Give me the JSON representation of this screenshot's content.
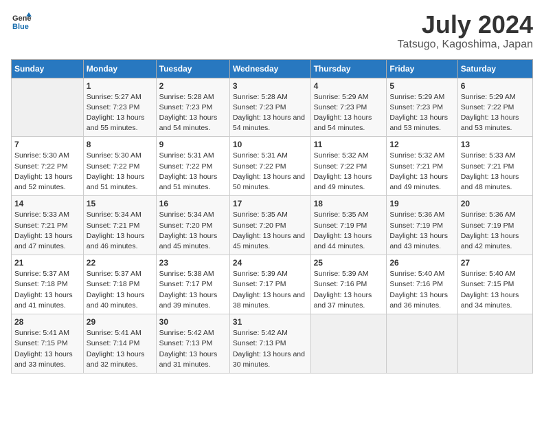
{
  "header": {
    "logo_line1": "General",
    "logo_line2": "Blue",
    "month": "July 2024",
    "location": "Tatsugo, Kagoshima, Japan"
  },
  "weekdays": [
    "Sunday",
    "Monday",
    "Tuesday",
    "Wednesday",
    "Thursday",
    "Friday",
    "Saturday"
  ],
  "weeks": [
    [
      {
        "day": "",
        "sunrise": "",
        "sunset": "",
        "daylight": ""
      },
      {
        "day": "1",
        "sunrise": "5:27 AM",
        "sunset": "7:23 PM",
        "daylight": "13 hours and 55 minutes."
      },
      {
        "day": "2",
        "sunrise": "5:28 AM",
        "sunset": "7:23 PM",
        "daylight": "13 hours and 54 minutes."
      },
      {
        "day": "3",
        "sunrise": "5:28 AM",
        "sunset": "7:23 PM",
        "daylight": "13 hours and 54 minutes."
      },
      {
        "day": "4",
        "sunrise": "5:29 AM",
        "sunset": "7:23 PM",
        "daylight": "13 hours and 54 minutes."
      },
      {
        "day": "5",
        "sunrise": "5:29 AM",
        "sunset": "7:23 PM",
        "daylight": "13 hours and 53 minutes."
      },
      {
        "day": "6",
        "sunrise": "5:29 AM",
        "sunset": "7:22 PM",
        "daylight": "13 hours and 53 minutes."
      }
    ],
    [
      {
        "day": "7",
        "sunrise": "5:30 AM",
        "sunset": "7:22 PM",
        "daylight": "13 hours and 52 minutes."
      },
      {
        "day": "8",
        "sunrise": "5:30 AM",
        "sunset": "7:22 PM",
        "daylight": "13 hours and 51 minutes."
      },
      {
        "day": "9",
        "sunrise": "5:31 AM",
        "sunset": "7:22 PM",
        "daylight": "13 hours and 51 minutes."
      },
      {
        "day": "10",
        "sunrise": "5:31 AM",
        "sunset": "7:22 PM",
        "daylight": "13 hours and 50 minutes."
      },
      {
        "day": "11",
        "sunrise": "5:32 AM",
        "sunset": "7:22 PM",
        "daylight": "13 hours and 49 minutes."
      },
      {
        "day": "12",
        "sunrise": "5:32 AM",
        "sunset": "7:21 PM",
        "daylight": "13 hours and 49 minutes."
      },
      {
        "day": "13",
        "sunrise": "5:33 AM",
        "sunset": "7:21 PM",
        "daylight": "13 hours and 48 minutes."
      }
    ],
    [
      {
        "day": "14",
        "sunrise": "5:33 AM",
        "sunset": "7:21 PM",
        "daylight": "13 hours and 47 minutes."
      },
      {
        "day": "15",
        "sunrise": "5:34 AM",
        "sunset": "7:21 PM",
        "daylight": "13 hours and 46 minutes."
      },
      {
        "day": "16",
        "sunrise": "5:34 AM",
        "sunset": "7:20 PM",
        "daylight": "13 hours and 45 minutes."
      },
      {
        "day": "17",
        "sunrise": "5:35 AM",
        "sunset": "7:20 PM",
        "daylight": "13 hours and 45 minutes."
      },
      {
        "day": "18",
        "sunrise": "5:35 AM",
        "sunset": "7:19 PM",
        "daylight": "13 hours and 44 minutes."
      },
      {
        "day": "19",
        "sunrise": "5:36 AM",
        "sunset": "7:19 PM",
        "daylight": "13 hours and 43 minutes."
      },
      {
        "day": "20",
        "sunrise": "5:36 AM",
        "sunset": "7:19 PM",
        "daylight": "13 hours and 42 minutes."
      }
    ],
    [
      {
        "day": "21",
        "sunrise": "5:37 AM",
        "sunset": "7:18 PM",
        "daylight": "13 hours and 41 minutes."
      },
      {
        "day": "22",
        "sunrise": "5:37 AM",
        "sunset": "7:18 PM",
        "daylight": "13 hours and 40 minutes."
      },
      {
        "day": "23",
        "sunrise": "5:38 AM",
        "sunset": "7:17 PM",
        "daylight": "13 hours and 39 minutes."
      },
      {
        "day": "24",
        "sunrise": "5:39 AM",
        "sunset": "7:17 PM",
        "daylight": "13 hours and 38 minutes."
      },
      {
        "day": "25",
        "sunrise": "5:39 AM",
        "sunset": "7:16 PM",
        "daylight": "13 hours and 37 minutes."
      },
      {
        "day": "26",
        "sunrise": "5:40 AM",
        "sunset": "7:16 PM",
        "daylight": "13 hours and 36 minutes."
      },
      {
        "day": "27",
        "sunrise": "5:40 AM",
        "sunset": "7:15 PM",
        "daylight": "13 hours and 34 minutes."
      }
    ],
    [
      {
        "day": "28",
        "sunrise": "5:41 AM",
        "sunset": "7:15 PM",
        "daylight": "13 hours and 33 minutes."
      },
      {
        "day": "29",
        "sunrise": "5:41 AM",
        "sunset": "7:14 PM",
        "daylight": "13 hours and 32 minutes."
      },
      {
        "day": "30",
        "sunrise": "5:42 AM",
        "sunset": "7:13 PM",
        "daylight": "13 hours and 31 minutes."
      },
      {
        "day": "31",
        "sunrise": "5:42 AM",
        "sunset": "7:13 PM",
        "daylight": "13 hours and 30 minutes."
      },
      {
        "day": "",
        "sunrise": "",
        "sunset": "",
        "daylight": ""
      },
      {
        "day": "",
        "sunrise": "",
        "sunset": "",
        "daylight": ""
      },
      {
        "day": "",
        "sunrise": "",
        "sunset": "",
        "daylight": ""
      }
    ]
  ]
}
